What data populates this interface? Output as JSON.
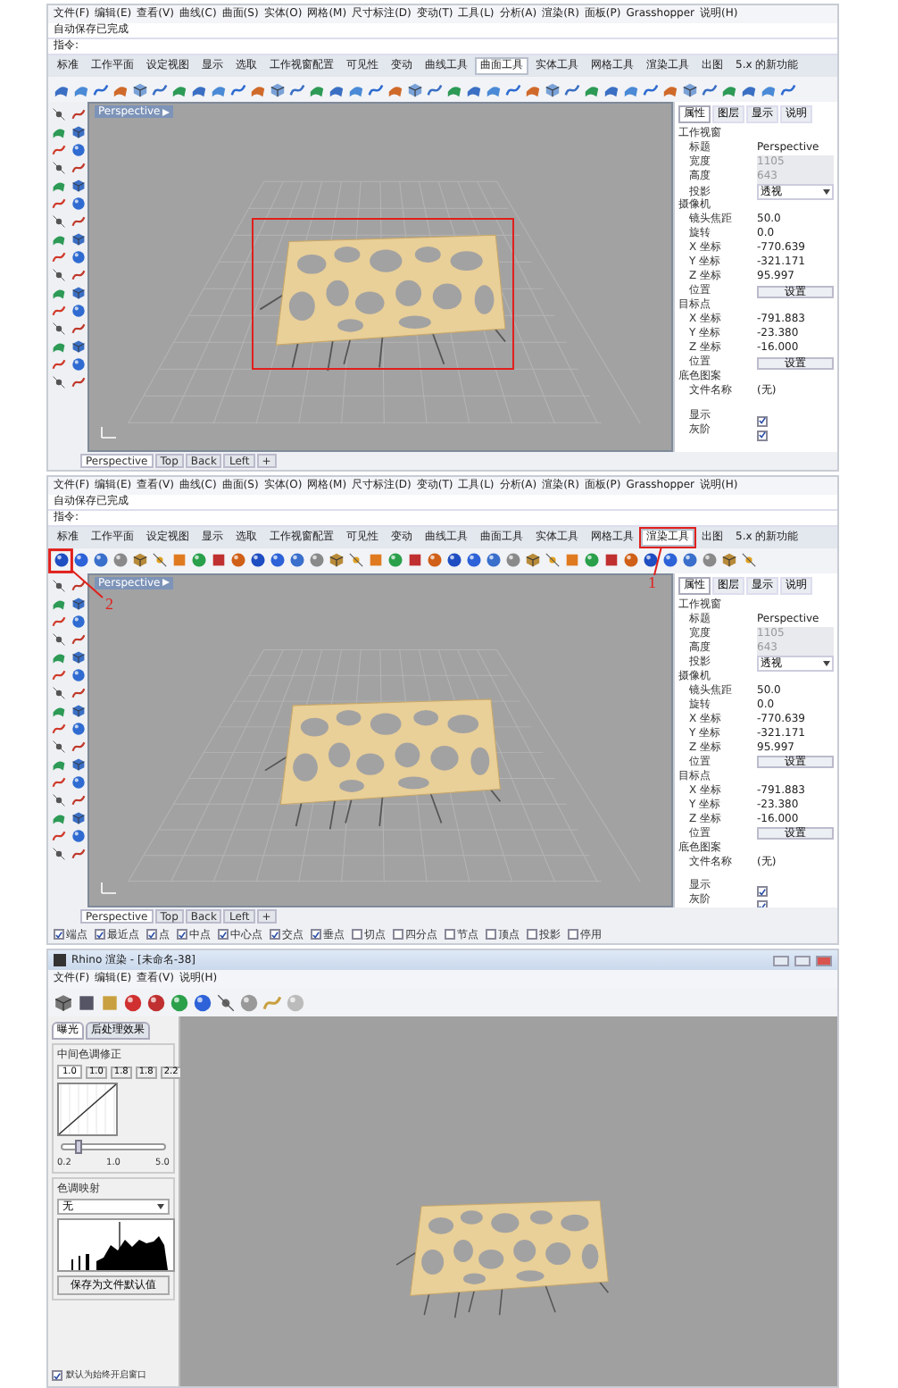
{
  "windows": [
    {
      "menu": [
        "文件(F)",
        "编辑(E)",
        "查看(V)",
        "曲线(C)",
        "曲面(S)",
        "实体(O)",
        "网格(M)",
        "尺寸标注(D)",
        "变动(T)",
        "工具(L)",
        "分析(A)",
        "渲染(R)",
        "面板(P)",
        "Grasshopper",
        "说明(H)"
      ],
      "command_history": "自动保存已完成",
      "command_prompt": "指令:",
      "toolbar_tabs": [
        {
          "label": "标准",
          "selected": false
        },
        {
          "label": "工作平面",
          "selected": false
        },
        {
          "label": "设定视图",
          "selected": false
        },
        {
          "label": "显示",
          "selected": false
        },
        {
          "label": "选取",
          "selected": false
        },
        {
          "label": "工作视窗配置",
          "selected": false
        },
        {
          "label": "可见性",
          "selected": false
        },
        {
          "label": "变动",
          "selected": false
        },
        {
          "label": "曲线工具",
          "selected": false
        },
        {
          "label": "曲面工具",
          "selected": true
        },
        {
          "label": "实体工具",
          "selected": false
        },
        {
          "label": "网格工具",
          "selected": false
        },
        {
          "label": "渲染工具",
          "selected": false
        },
        {
          "label": "出图",
          "selected": false
        },
        {
          "label": "5.x 的新功能",
          "selected": false
        }
      ],
      "toolbar": {
        "kind": "surface"
      },
      "viewport": {
        "title": "Perspective",
        "selection_frame": true
      },
      "properties": {
        "tabs": [
          {
            "label": "属性",
            "selected": true
          },
          {
            "label": "图层",
            "selected": false
          },
          {
            "label": "显示",
            "selected": false
          },
          {
            "label": "说明",
            "selected": false
          }
        ],
        "sections": [
          {
            "title": "工作视窗",
            "rows": [
              {
                "label": "标题",
                "kind": "text",
                "value": "Perspective"
              },
              {
                "label": "宽度",
                "kind": "readonly",
                "value": "1105"
              },
              {
                "label": "高度",
                "kind": "readonly",
                "value": "643"
              },
              {
                "label": "投影",
                "kind": "dropdown",
                "value": "透视"
              }
            ]
          },
          {
            "title": "摄像机",
            "rows": [
              {
                "label": "镜头焦距",
                "kind": "text",
                "value": "50.0"
              },
              {
                "label": "旋转",
                "kind": "text",
                "value": "0.0"
              },
              {
                "label": "X 坐标",
                "kind": "text",
                "value": "-770.639"
              },
              {
                "label": "Y 坐标",
                "kind": "text",
                "value": "-321.171"
              },
              {
                "label": "Z 坐标",
                "kind": "text",
                "value": "95.997"
              },
              {
                "label": "位置",
                "kind": "button",
                "value": "设置"
              }
            ]
          },
          {
            "title": "目标点",
            "rows": [
              {
                "label": "X 坐标",
                "kind": "text",
                "value": "-791.883"
              },
              {
                "label": "Y 坐标",
                "kind": "text",
                "value": "-23.380"
              },
              {
                "label": "Z 坐标",
                "kind": "text",
                "value": "-16.000"
              },
              {
                "label": "位置",
                "kind": "button",
                "value": "设置"
              }
            ]
          },
          {
            "title": "底色图案",
            "rows": [
              {
                "label": "文件名称",
                "kind": "text",
                "value": "(无)"
              },
              {
                "label": "显示",
                "kind": "checkbox",
                "checked": true
              },
              {
                "label": "灰阶",
                "kind": "checkbox",
                "checked": true
              }
            ]
          }
        ]
      },
      "viewport_tabs": [
        {
          "label": "Perspective",
          "selected": true
        },
        {
          "label": "Top",
          "selected": false
        },
        {
          "label": "Back",
          "selected": false
        },
        {
          "label": "Left",
          "selected": false
        },
        {
          "label": "+",
          "selected": false
        }
      ]
    },
    {
      "menu": [
        "文件(F)",
        "编辑(E)",
        "查看(V)",
        "曲线(C)",
        "曲面(S)",
        "实体(O)",
        "网格(M)",
        "尺寸标注(D)",
        "变动(T)",
        "工具(L)",
        "分析(A)",
        "渲染(R)",
        "面板(P)",
        "Grasshopper",
        "说明(H)"
      ],
      "command_history": "自动保存已完成",
      "command_prompt": "指令:",
      "toolbar_tabs": [
        {
          "label": "标准",
          "selected": false
        },
        {
          "label": "工作平面",
          "selected": false
        },
        {
          "label": "设定视图",
          "selected": false
        },
        {
          "label": "显示",
          "selected": false
        },
        {
          "label": "选取",
          "selected": false
        },
        {
          "label": "工作视窗配置",
          "selected": false
        },
        {
          "label": "可见性",
          "selected": false
        },
        {
          "label": "变动",
          "selected": false
        },
        {
          "label": "曲线工具",
          "selected": false
        },
        {
          "label": "曲面工具",
          "selected": false
        },
        {
          "label": "实体工具",
          "selected": false
        },
        {
          "label": "网格工具",
          "selected": false
        },
        {
          "label": "渲染工具",
          "selected": true,
          "callout": "1"
        },
        {
          "label": "出图",
          "selected": false
        },
        {
          "label": "5.x 的新功能",
          "selected": false
        }
      ],
      "toolbar": {
        "kind": "render",
        "callout": "2"
      },
      "viewport": {
        "title": "Perspective",
        "selection_frame": false
      },
      "properties": {
        "tabs": [
          {
            "label": "属性",
            "selected": true
          },
          {
            "label": "图层",
            "selected": false
          },
          {
            "label": "显示",
            "selected": false
          },
          {
            "label": "说明",
            "selected": false
          }
        ],
        "sections": [
          {
            "title": "工作视窗",
            "rows": [
              {
                "label": "标题",
                "kind": "text",
                "value": "Perspective"
              },
              {
                "label": "宽度",
                "kind": "readonly",
                "value": "1105"
              },
              {
                "label": "高度",
                "kind": "readonly",
                "value": "643"
              },
              {
                "label": "投影",
                "kind": "dropdown",
                "value": "透视"
              }
            ]
          },
          {
            "title": "摄像机",
            "rows": [
              {
                "label": "镜头焦距",
                "kind": "text",
                "value": "50.0"
              },
              {
                "label": "旋转",
                "kind": "text",
                "value": "0.0"
              },
              {
                "label": "X 坐标",
                "kind": "text",
                "value": "-770.639"
              },
              {
                "label": "Y 坐标",
                "kind": "text",
                "value": "-321.171"
              },
              {
                "label": "Z 坐标",
                "kind": "text",
                "value": "95.997"
              },
              {
                "label": "位置",
                "kind": "button",
                "value": "设置"
              }
            ]
          },
          {
            "title": "目标点",
            "rows": [
              {
                "label": "X 坐标",
                "kind": "text",
                "value": "-791.883"
              },
              {
                "label": "Y 坐标",
                "kind": "text",
                "value": "-23.380"
              },
              {
                "label": "Z 坐标",
                "kind": "text",
                "value": "-16.000"
              },
              {
                "label": "位置",
                "kind": "button",
                "value": "设置"
              }
            ]
          },
          {
            "title": "底色图案",
            "rows": [
              {
                "label": "文件名称",
                "kind": "text",
                "value": "(无)"
              },
              {
                "label": "显示",
                "kind": "checkbox",
                "checked": true
              },
              {
                "label": "灰阶",
                "kind": "checkbox",
                "checked": true
              }
            ]
          }
        ]
      },
      "viewport_tabs": [
        {
          "label": "Perspective",
          "selected": true
        },
        {
          "label": "Top",
          "selected": false
        },
        {
          "label": "Back",
          "selected": false
        },
        {
          "label": "Left",
          "selected": false
        },
        {
          "label": "+",
          "selected": false
        }
      ],
      "osnaps": [
        {
          "label": "端点",
          "checked": true
        },
        {
          "label": "最近点",
          "checked": true
        },
        {
          "label": "点",
          "checked": true
        },
        {
          "label": "中点",
          "checked": true
        },
        {
          "label": "中心点",
          "checked": true
        },
        {
          "label": "交点",
          "checked": true
        },
        {
          "label": "垂点",
          "checked": true
        },
        {
          "label": "切点",
          "checked": false
        },
        {
          "label": "四分点",
          "checked": false
        },
        {
          "label": "节点",
          "checked": false
        },
        {
          "label": "顶点",
          "checked": false
        },
        {
          "label": "投影",
          "checked": false
        },
        {
          "label": "停用",
          "checked": false
        }
      ]
    }
  ],
  "render_window": {
    "title": "Rhino 渲染 - [未命名-38]",
    "menu": [
      "文件(F)",
      "编辑(E)",
      "查看(V)",
      "说明(H)"
    ],
    "panel_tabs": [
      {
        "label": "曝光",
        "selected": true
      },
      {
        "label": "后处理效果",
        "selected": false
      }
    ],
    "midtone": {
      "title": "中间色调修正",
      "value": "1.0",
      "presets": [
        "1.0",
        "1.8",
        "1.8",
        "2.2"
      ],
      "slider": {
        "level": 0.15
      },
      "slider_labels": [
        "0.2",
        "1.0",
        "5.0"
      ]
    },
    "tone_mapping": {
      "title": "色调映射",
      "value": "无"
    },
    "save_button": "保存为文件默认值",
    "auto_open": {
      "label": "默认为始终开启窗口",
      "checked": true
    }
  }
}
